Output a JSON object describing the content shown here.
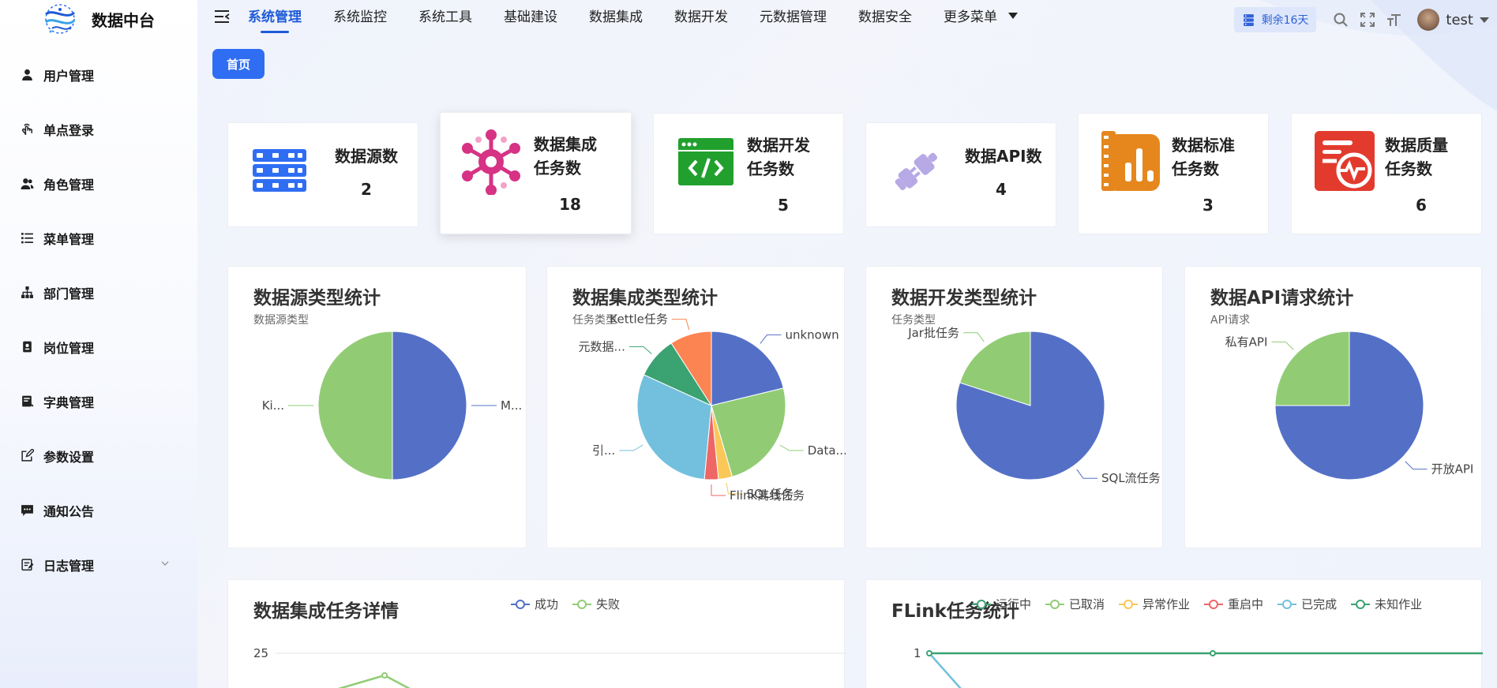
{
  "app": {
    "title": "数据中台"
  },
  "sidebar": {
    "items": [
      {
        "label": "用户管理",
        "icon": "user-icon"
      },
      {
        "label": "单点登录",
        "icon": "touch-icon"
      },
      {
        "label": "角色管理",
        "icon": "users-icon"
      },
      {
        "label": "菜单管理",
        "icon": "menu-list-icon"
      },
      {
        "label": "部门管理",
        "icon": "org-tree-icon"
      },
      {
        "label": "岗位管理",
        "icon": "badge-icon"
      },
      {
        "label": "字典管理",
        "icon": "dictionary-icon"
      },
      {
        "label": "参数设置",
        "icon": "edit-icon"
      },
      {
        "label": "通知公告",
        "icon": "message-icon"
      },
      {
        "label": "日志管理",
        "icon": "log-icon"
      }
    ]
  },
  "topnav": {
    "tabs": [
      "系统管理",
      "系统监控",
      "系统工具",
      "基础建设",
      "数据集成",
      "数据开发",
      "元数据管理",
      "数据安全",
      "更多菜单"
    ],
    "active": "系统管理",
    "remain": "剩余16天",
    "user": "test"
  },
  "breadcrumb": {
    "home": "首页"
  },
  "stats": [
    {
      "label1": "数据源数",
      "label2": "",
      "value": "2",
      "icon": "database-server-icon",
      "color": "#2f6ef3"
    },
    {
      "label1": "数据集成",
      "label2": "任务数",
      "value": "18",
      "icon": "network-hub-icon",
      "color": "#d63384"
    },
    {
      "label1": "数据开发",
      "label2": "任务数",
      "value": "5",
      "icon": "code-window-icon",
      "color": "#22a02e"
    },
    {
      "label1": "数据API数",
      "label2": "",
      "value": "4",
      "icon": "plug-link-icon",
      "color": "#b7a9e6"
    },
    {
      "label1": "数据标准",
      "label2": "任务数",
      "value": "3",
      "icon": "standard-chart-icon",
      "color": "#e5871d"
    },
    {
      "label1": "数据质量",
      "label2": "任务数",
      "value": "6",
      "icon": "quality-monitor-icon",
      "color": "#e23b2e"
    }
  ],
  "colors": {
    "blue": "#5470c6",
    "green": "#91cc75",
    "yellow": "#fac858",
    "red": "#ee6666",
    "cyan": "#73c0de",
    "teal": "#3ba272",
    "orange": "#fc8452"
  },
  "chart_data": [
    {
      "type": "pie",
      "title": "数据源类型统计",
      "subtitle": "数据源类型",
      "slices": [
        {
          "name": "M...",
          "value": 1,
          "color": "#5470c6"
        },
        {
          "name": "Ki...",
          "value": 1,
          "color": "#91cc75"
        }
      ]
    },
    {
      "type": "pie",
      "title": "数据集成类型统计",
      "subtitle": "任务类型",
      "slices": [
        {
          "name": "unknown",
          "value": 3.5,
          "color": "#5470c6"
        },
        {
          "name": "Data...",
          "value": 4,
          "color": "#91cc75"
        },
        {
          "name": "SQL任务",
          "value": 0.5,
          "color": "#fac858"
        },
        {
          "name": "Flink离线任务",
          "value": 0.5,
          "color": "#ee6666"
        },
        {
          "name": "引...",
          "value": 5,
          "color": "#73c0de"
        },
        {
          "name": "元数据...",
          "value": 1.5,
          "color": "#3ba272"
        },
        {
          "name": "Kettle任务",
          "value": 1.5,
          "color": "#fc8452"
        }
      ]
    },
    {
      "type": "pie",
      "title": "数据开发类型统计",
      "subtitle": "任务类型",
      "slices": [
        {
          "name": "SQL流任务",
          "value": 4,
          "color": "#5470c6"
        },
        {
          "name": "Jar批任务",
          "value": 1,
          "color": "#91cc75"
        }
      ]
    },
    {
      "type": "pie",
      "title": "数据API请求统计",
      "subtitle": "API请求",
      "slices": [
        {
          "name": "开放API",
          "value": 3,
          "color": "#5470c6"
        },
        {
          "name": "私有API",
          "value": 1,
          "color": "#91cc75"
        }
      ]
    },
    {
      "type": "line",
      "title": "数据集成任务详情",
      "series": [
        {
          "name": "成功",
          "color": "#5470c6"
        },
        {
          "name": "失败",
          "color": "#91cc75"
        }
      ],
      "y_ticks": [
        "25"
      ]
    },
    {
      "type": "line",
      "title": "FLink任务统计",
      "series": [
        {
          "name": "运行中",
          "color": "#3ba272"
        },
        {
          "name": "已取消",
          "color": "#91cc75"
        },
        {
          "name": "异常作业",
          "color": "#fac858"
        },
        {
          "name": "重启中",
          "color": "#ee6666"
        },
        {
          "name": "已完成",
          "color": "#73c0de"
        },
        {
          "name": "未知作业",
          "color": "#3ba272"
        }
      ],
      "y_ticks": [
        "1"
      ]
    }
  ]
}
